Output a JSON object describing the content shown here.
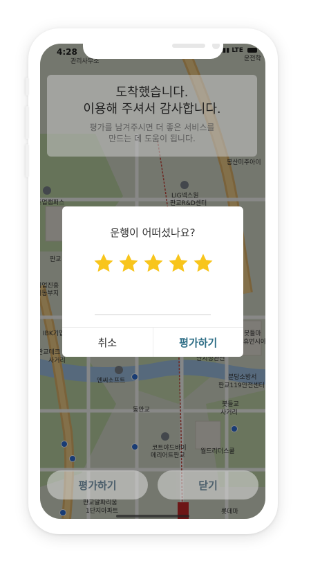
{
  "status_bar": {
    "time": "4:28",
    "network": "LTE"
  },
  "map": {
    "labels": [
      "관리사무소",
      "운전학",
      "봉산미주아이",
      "LIG넥스원",
      "판교R&D센터",
      "트업캠퍼스",
      "판교",
      "기업진흥",
      "기동부지",
      "IBK기업",
      "봇들마",
      "휴먼시아",
      "판교테크",
      "사거리",
      "안치정관전",
      "엔씨소프트",
      "분당소방서",
      "판교119안전센터",
      "동안교",
      "봇들교",
      "사거리",
      "코트야드바이",
      "메리어트판교",
      "월드리더스쿨",
      "판교알파리움",
      "1단지아파트",
      "롯데마"
    ]
  },
  "arrival": {
    "title_line1": "도착했습니다.",
    "title_line2": "이용해 주셔서 감사합니다.",
    "sub_line1": "평가를 남겨주시면 더 좋은 서비스를",
    "sub_line2": "만드는 데 도움이 됩니다."
  },
  "dialog": {
    "title": "운행이 어떠셨나요?",
    "rating": 5,
    "max_rating": 5,
    "comment": "",
    "cancel_label": "취소",
    "submit_label": "평가하기"
  },
  "bottom": {
    "rate_label": "평가하기",
    "close_label": "닫기"
  },
  "colors": {
    "star": "#f8c51c",
    "accent": "#2e6e86",
    "button_text": "#2a4a6a"
  }
}
